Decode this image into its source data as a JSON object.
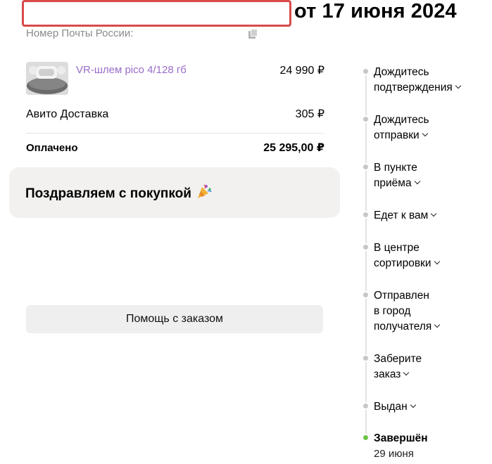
{
  "header": {
    "title_date": "от 17 июня 2024"
  },
  "post": {
    "label": "Номер Почты России:"
  },
  "order": {
    "item_name": "VR-шлем pico 4/128 гб",
    "item_price": "24 990 ₽",
    "delivery_label": "Авито Доставка",
    "delivery_price": "305 ₽",
    "paid_label": "Оплачено",
    "paid_total": "25 295,00 ₽"
  },
  "congrats": {
    "text": "Поздравляем с покупкой"
  },
  "help": {
    "label": "Помощь с заказом"
  },
  "timeline": {
    "steps": [
      {
        "line1": "Дождитесь",
        "line2": "подтверждения"
      },
      {
        "line1": "Дождитесь",
        "line2": "отправки"
      },
      {
        "line1": "В пункте",
        "line2": "приёма"
      },
      {
        "line1": "Едет к вам"
      },
      {
        "line1": "В центре",
        "line2": "сортировки"
      },
      {
        "line1": "Отправлен",
        "line2": "в город",
        "line3": "получателя"
      },
      {
        "line1": "Заберите",
        "line2": "заказ"
      },
      {
        "line1": "Выдан"
      }
    ],
    "final": {
      "label": "Завершён",
      "date": "29 июня"
    }
  },
  "colors": {
    "highlight_border": "#d94a4a",
    "item_link": "#9a6cc9",
    "done_dot": "#6fc44a"
  }
}
